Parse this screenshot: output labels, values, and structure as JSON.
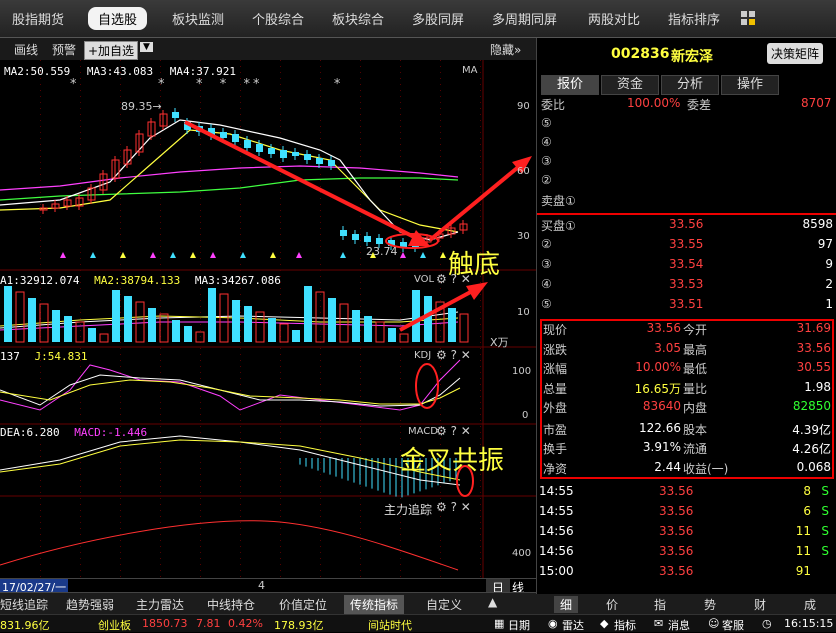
{
  "topnav": {
    "tabs": [
      "股指期货",
      "自选股",
      "板块监测",
      "个股综合",
      "板块综合",
      "多股同屏",
      "多周期同屏",
      "两股对比",
      "指标排序"
    ],
    "active": "自选股"
  },
  "toolbar": {
    "huaxian": "画线",
    "yujing": "预警",
    "add_watch": "+加自选",
    "hide": "隐藏»"
  },
  "ma_line": {
    "ma2": "MA2:50.559",
    "ma3": "MA3:43.083",
    "ma4": "MA4:37.921",
    "ma": "MA"
  },
  "price_axis": [
    "90",
    "60",
    "30"
  ],
  "high_label": "89.35",
  "low_label": "23.74",
  "vol_line": {
    "ma1": "A1:32912.074",
    "ma2": "MA2:38794.133",
    "ma3": "MA3:34267.086",
    "vol": "VOL"
  },
  "vol_axis": [
    "10"
  ],
  "vol_unit": "X万",
  "kdj_line": {
    "v": "137",
    "j": "J:54.831",
    "name": "KDJ"
  },
  "kdj_axis": [
    "100",
    "0"
  ],
  "macd_line": {
    "dea": "DEA:6.280",
    "macd": "MACD:-1.446",
    "name": "MACD"
  },
  "zhuli": {
    "name": "主力追踪",
    "axis": "400"
  },
  "date_label": "17/02/27/一",
  "cursor_num": "4",
  "period_btns": {
    "ri": "日",
    "xian": "线"
  },
  "annotations": {
    "chudi": "触底",
    "jinchagongzhen": "金叉共振"
  },
  "bottom_tabs": [
    "短线追踪",
    "趋势强弱",
    "主力雷达",
    "中线持仓",
    "价值定位",
    "传统指标",
    "自定义"
  ],
  "bottom_active": "传统指标",
  "stock": {
    "code": "002836",
    "name": "新宏泽",
    "btn": "决策矩阵"
  },
  "right_tabs": [
    "报价",
    "资金",
    "分析",
    "操作"
  ],
  "weibi": {
    "label1": "委比",
    "v1": "100.00%",
    "label2": "委差",
    "v2": "8707"
  },
  "sell": [
    {
      "lvl": "⑤"
    },
    {
      "lvl": "④"
    },
    {
      "lvl": "③"
    },
    {
      "lvl": "②"
    },
    {
      "lvl": "卖盘①"
    }
  ],
  "buy": [
    {
      "lvl": "买盘①",
      "price": "33.56",
      "vol": "8598"
    },
    {
      "lvl": "②",
      "price": "33.55",
      "vol": "97"
    },
    {
      "lvl": "③",
      "price": "33.54",
      "vol": "9"
    },
    {
      "lvl": "④",
      "price": "33.53",
      "vol": "2"
    },
    {
      "lvl": "⑤",
      "price": "33.51",
      "vol": "1"
    }
  ],
  "quote": [
    {
      "l1": "现价",
      "v1": "33.56",
      "l2": "今开",
      "v2": "31.69"
    },
    {
      "l1": "涨跌",
      "v1": "3.05",
      "l2": "最高",
      "v2": "33.56"
    },
    {
      "l1": "涨幅",
      "v1": "10.00%",
      "l2": "最低",
      "v2": "30.55"
    },
    {
      "l1": "总量",
      "v1": "16.65万",
      "l2": "量比",
      "v2": "1.98"
    },
    {
      "l1": "外盘",
      "v1": "83640",
      "l2": "内盘",
      "v2": "82850"
    },
    {
      "l1": "市盈",
      "v1": "122.66",
      "l2": "股本",
      "v2": "4.39亿"
    },
    {
      "l1": "换手",
      "v1": "3.91%",
      "l2": "流通",
      "v2": "4.26亿"
    },
    {
      "l1": "净资",
      "v1": "2.44",
      "l2": "收益(一)",
      "v2": "0.068"
    }
  ],
  "ticks": [
    {
      "t": "14:55",
      "p": "33.56",
      "v": "8",
      "f": "S"
    },
    {
      "t": "14:55",
      "p": "33.56",
      "v": "6",
      "f": "S"
    },
    {
      "t": "14:56",
      "p": "33.56",
      "v": "11",
      "f": "S"
    },
    {
      "t": "14:56",
      "p": "33.56",
      "v": "11",
      "f": "S"
    },
    {
      "t": "15:00",
      "p": "33.56",
      "v": "91",
      "f": ""
    }
  ],
  "right_bottom_tabs": [
    "细",
    "价",
    "指",
    "势",
    "财",
    "成"
  ],
  "status": {
    "idx1": "831.96亿",
    "cyb": "创业板",
    "cyb_v": "1850.73",
    "cyb_c": "7.81",
    "cyb_p": "0.42%",
    "cyb_a": "178.93亿",
    "jianzhan": "间站时代",
    "riqi": "日期",
    "leida": "雷达",
    "zhibiao": "指标",
    "xiaoxi": "消息",
    "kefu": "客服",
    "time": "16:15:15"
  }
}
